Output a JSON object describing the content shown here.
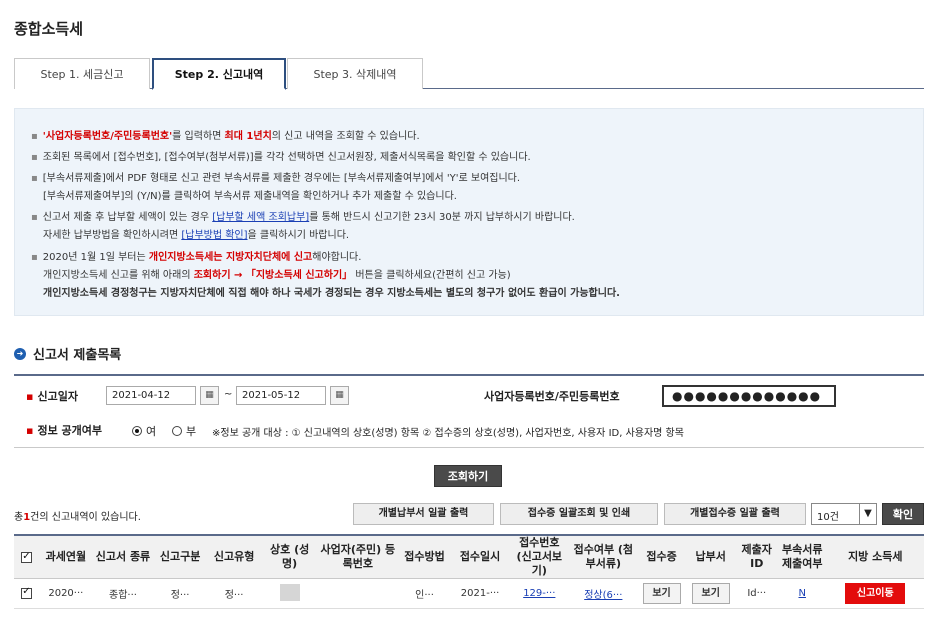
{
  "page_title": "종합소득세",
  "tabs": [
    {
      "label": "Step 1. 세금신고"
    },
    {
      "label": "Step 2. 신고내역"
    },
    {
      "label": "Step 3. 삭제내역"
    }
  ],
  "notice": {
    "l1_a": "'사업자등록번호/주민등록번호'",
    "l1_b": "를 입력하면 ",
    "l1_c": "최대 1년치",
    "l1_d": "의 신고 내역을 조회할 수 있습니다.",
    "l2": "조회된 목록에서 [접수번호], [접수여부(첨부서류)]를 각각 선택하면 신고서원장, 제출서식목록을 확인할 수 있습니다.",
    "l3a": "[부속서류제출]에서 PDF 형태로 신고 관련 부속서류를 제출한 경우에는 [부속서류제출여부]에서 'Y'로 보여집니다.",
    "l3b": "[부속서류제출여부]의 (Y/N)를 클릭하여 부속서류 제출내역을 확인하거나 추가 제출할 수 있습니다.",
    "l4a_a": "신고서 제출 후 납부할 세액이 있는 경우 ",
    "l4a_link": "[납부할 세액 조회납부]",
    "l4a_b": "를 통해 반드시 신고기한 23시 30분 까지 납부하시기 바랍니다.",
    "l4b_a": "자세한 납부방법을 확인하시려면 ",
    "l4b_link": "[납부방법 확인]",
    "l4b_b": "을 클릭하시기 바랍니다.",
    "l5a_a": "2020년 1월 1일 부터는 ",
    "l5a_b": "개인지방소득세는 지방자치단체에 신고",
    "l5a_c": "해야합니다.",
    "l5b_a": "개인지방소득세 신고를 위해 아래의 ",
    "l5b_b": "조회하기 → 「지방소득세 신고하기」",
    "l5b_c": " 버튼을 클릭하세요(간편히 신고 가능)",
    "l5c": "개인지방소득세 경정청구는 지방자치단체에 직접 해야 하나 국세가 경정되는 경우 지방소득세는 별도의 청구가 없어도 환급이 가능합니다."
  },
  "section_title": "신고서 제출목록",
  "search": {
    "date_label": "신고일자",
    "date_from": "2021-04-12",
    "date_sep": "~",
    "date_to": "2021-05-12",
    "id_label": "사업자등록번호/주민등록번호",
    "id_value": "●●●●●●●●●●●●●",
    "disclosure_label": "정보 공개여부",
    "yes": "여",
    "no": "부",
    "note": "※정보 공개 대상 : ① 신고내역의 상호(성명) 항목 ② 접수증의 상호(성명), 사업자번호, 사용자 ID, 사용자명 항목",
    "submit": "조회하기"
  },
  "result": {
    "count_prefix": "총",
    "count": "1",
    "count_suffix": "건의 신고내역이 있습니다.",
    "btn_bill": "개별납부서 일괄 출력",
    "btn_receipt_print": "접수증 일괄조회 및 인쇄",
    "btn_receipt_each": "개별접수증 일괄 출력",
    "page_size": "10건",
    "confirm": "확인"
  },
  "table": {
    "headers": {
      "period": "과세연월",
      "kind": "신고서 종류",
      "category": "신고구분",
      "type": "신고유형",
      "name": "상호 (성명)",
      "bizno": "사업자(주민) 등록번호",
      "method": "접수방법",
      "date": "접수일시",
      "receipt_no": "접수번호 (신고서보기)",
      "status": "접수여부 (첨부서류)",
      "receipt": "접수증",
      "bill": "납부서",
      "submitter": "제출자 ID",
      "attach": "부속서류 제출여부",
      "local": "지방 소득세"
    },
    "row": {
      "period": "2020···",
      "kind": "종합···",
      "category": "정···",
      "type": "정···",
      "bizno": "",
      "method": "인···",
      "date": "2021-···",
      "receipt_no": "129-···",
      "status": "정상(6···",
      "receipt_btn": "보기",
      "bill_btn": "보기",
      "submitter": "Id···",
      "attach": "N",
      "local_btn": "신고이동"
    }
  }
}
